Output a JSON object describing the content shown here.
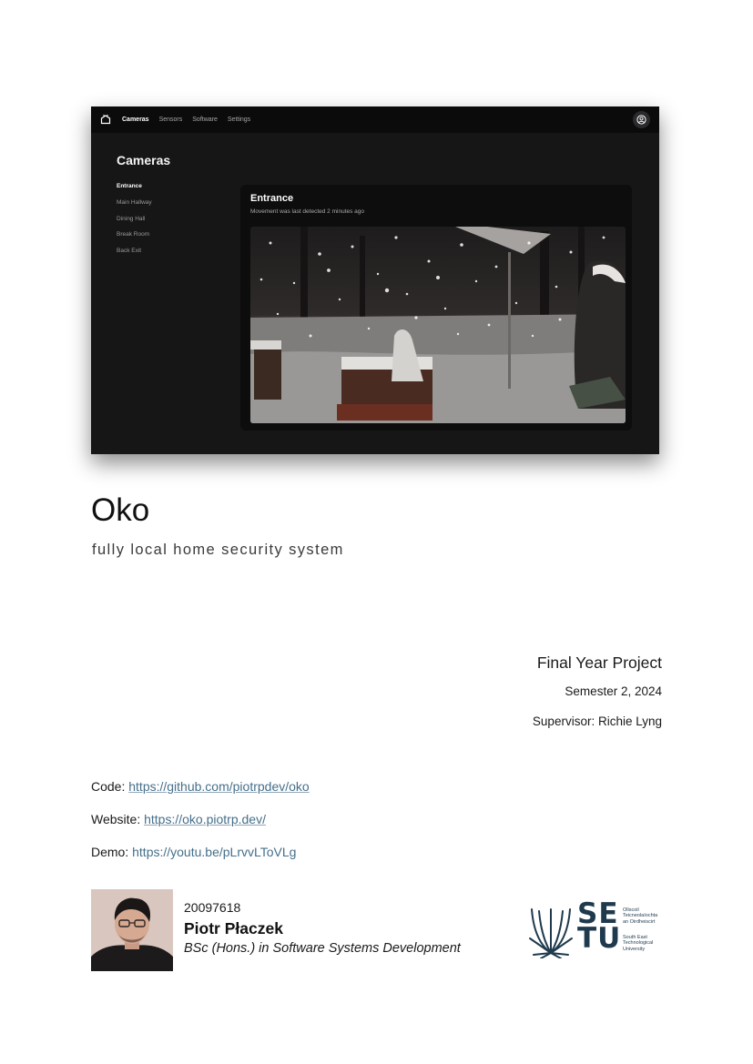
{
  "app": {
    "nav": [
      "Cameras",
      "Sensors",
      "Software",
      "Settings"
    ],
    "page_heading": "Cameras",
    "sidebar": [
      "Entrance",
      "Main Hallway",
      "Dining Hall",
      "Break Room",
      "Back Exit"
    ],
    "card": {
      "title": "Entrance",
      "subtitle": "Movement was last detected 2 minutes ago"
    },
    "icons": [
      "home-icon",
      "account-icon"
    ]
  },
  "document": {
    "title": "Oko",
    "subtitle": "fully local home security system",
    "project": "Final Year Project",
    "semester": "Semester 2, 2024",
    "supervisor": "Supervisor: Richie Lyng",
    "links": [
      {
        "label": "Code: ",
        "url": "https://github.com/piotrpdev/oko"
      },
      {
        "label": "Website: ",
        "url": "https://oko.piotrp.dev/"
      },
      {
        "label": "Demo: ",
        "url": "https://youtu.be/pLrvvLToVLg"
      }
    ],
    "author": {
      "student_id": "20097618",
      "name": "Piotr Płaczek",
      "course": "BSc (Hons.) in Software Systems Development"
    },
    "logo": {
      "letters": [
        "S",
        "E",
        "T",
        "U"
      ],
      "irish_name": [
        "Ollscoil",
        "Teicneolaíochta",
        "an Oirdheiscirt"
      ],
      "english_name": [
        "South East",
        "Technological",
        "University"
      ]
    }
  },
  "colors": {
    "app_background": "#161617",
    "link": "#456f8a",
    "logo": "#1f3a4d"
  }
}
